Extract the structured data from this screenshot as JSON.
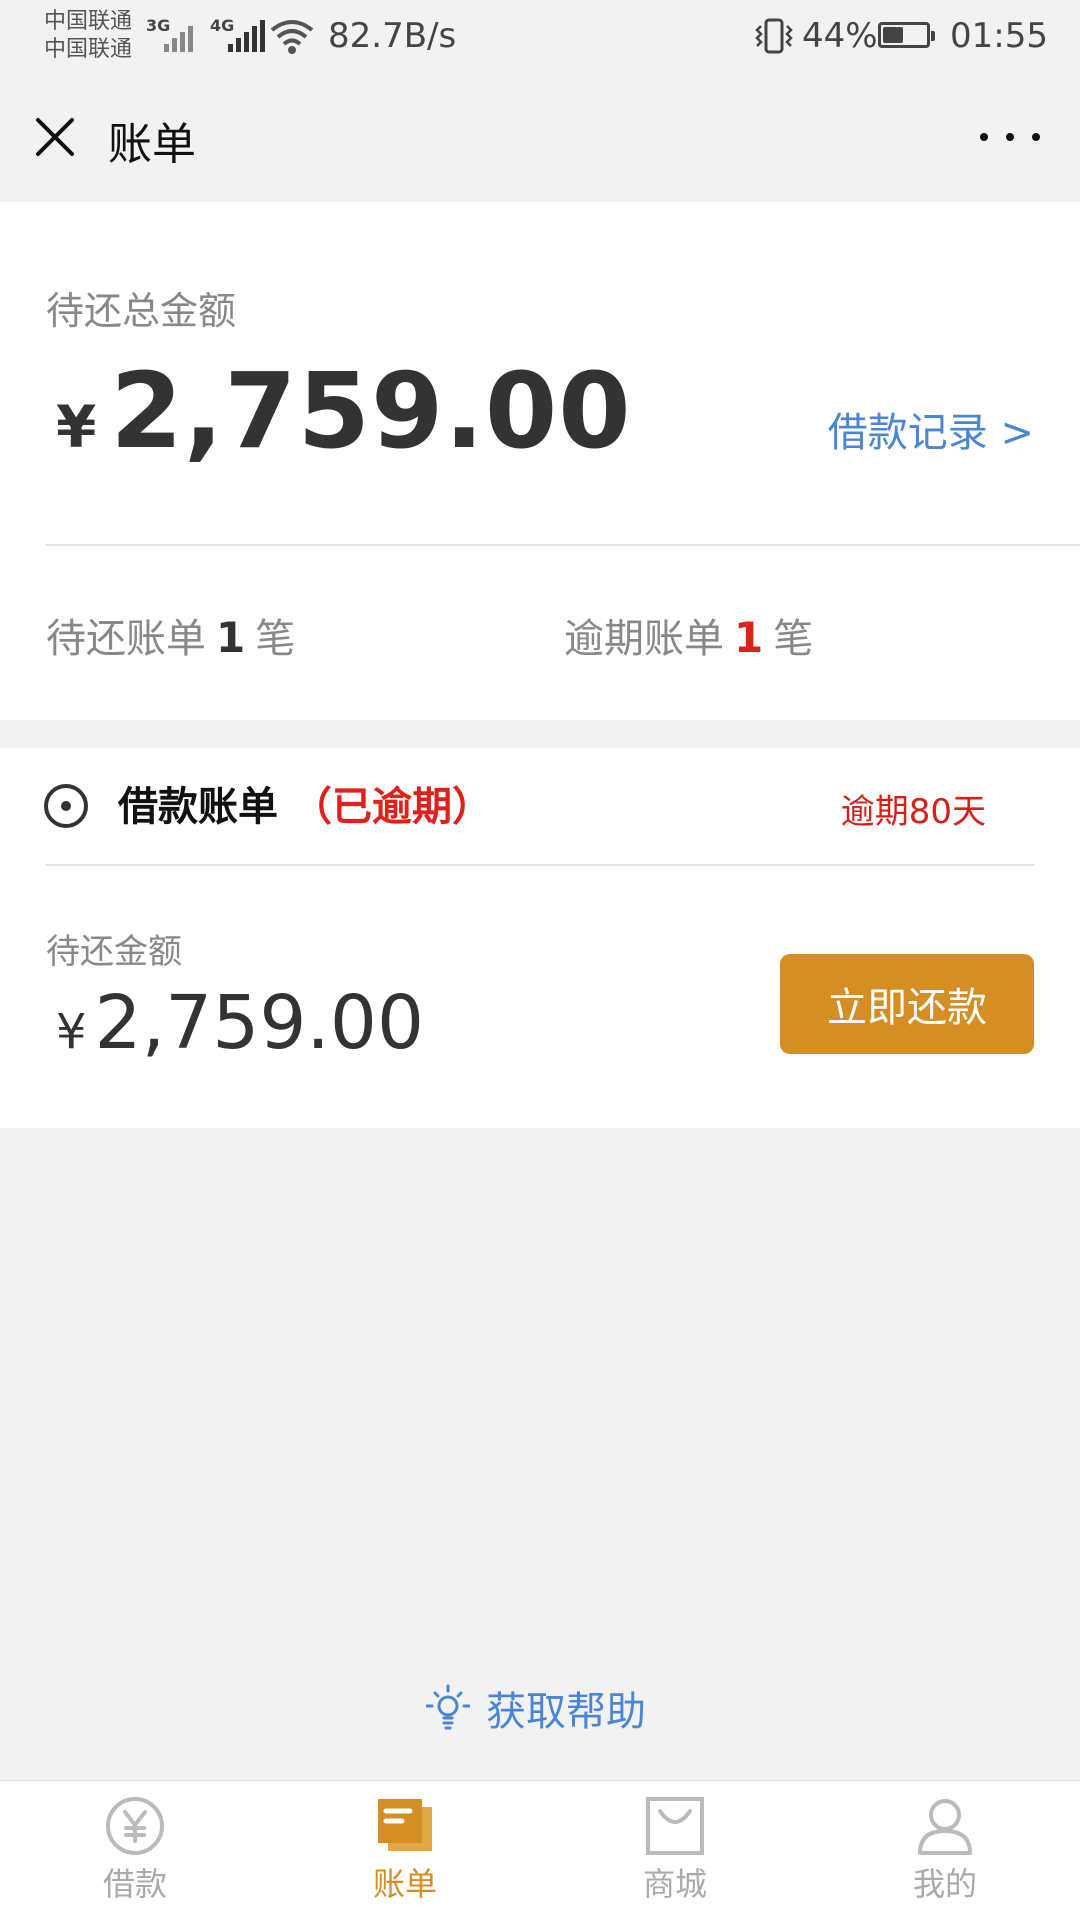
{
  "status_bar": {
    "carrier_1": "中国联通",
    "carrier_2": "中国联通",
    "net_type_1": "3G",
    "net_type_2": "4G",
    "net_speed": "82.7B/s",
    "battery_percent": "44%",
    "time": "01:55",
    "icons": [
      "signal-3g-icon",
      "signal-4g-icon",
      "wifi-icon",
      "vibrate-icon",
      "battery-icon"
    ]
  },
  "nav": {
    "title": "账单",
    "close_icon": "close-icon",
    "more_icon": "more-icon"
  },
  "summary": {
    "label": "待还总金额",
    "currency": "¥",
    "amount": "2,759.00",
    "records_link": "借款记录 >",
    "pending_prefix": "待还账单",
    "pending_count": "1",
    "pending_unit": "笔",
    "overdue_prefix": "逾期账单",
    "overdue_count": "1",
    "overdue_unit": "笔"
  },
  "bill": {
    "title": "借款账单",
    "status": "（已逾期）",
    "overdue_days": "逾期80天",
    "due_label": "待还金额",
    "currency": "¥",
    "due_amount": "2,759.00",
    "repay_button": "立即还款"
  },
  "help": {
    "label": "获取帮助",
    "icon": "lightbulb-icon"
  },
  "tabs": [
    {
      "label": "借款",
      "icon": "yuan-icon",
      "active": false
    },
    {
      "label": "账单",
      "icon": "bill-icon",
      "active": true
    },
    {
      "label": "商城",
      "icon": "shop-icon",
      "active": false
    },
    {
      "label": "我的",
      "icon": "user-icon",
      "active": false
    }
  ],
  "colors": {
    "accent": "#d58e24",
    "link": "#4a86d8",
    "danger": "#e0201b",
    "background": "#f2f2f2"
  }
}
